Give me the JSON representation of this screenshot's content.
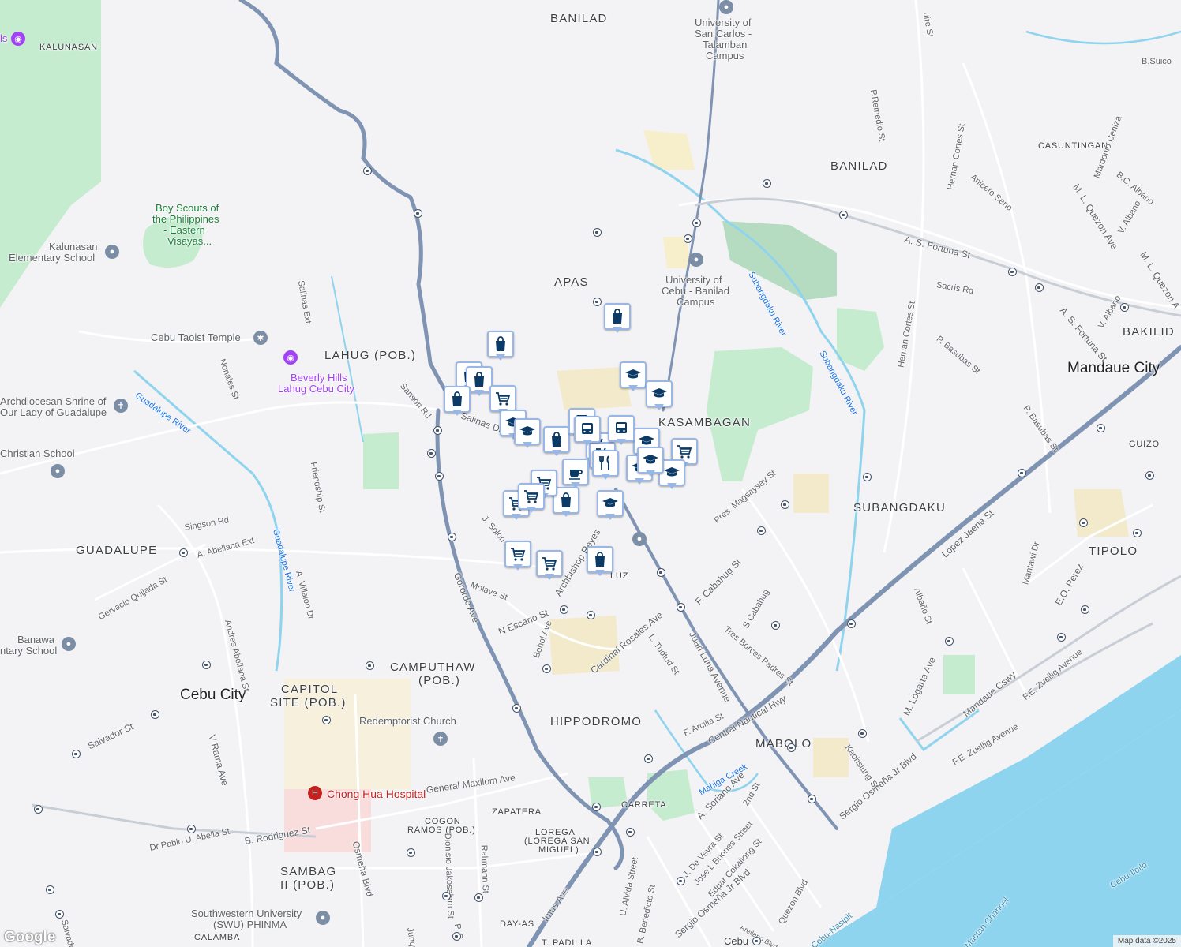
{
  "colors": {
    "background": "#f3f2f4",
    "park": "#c6ecd0",
    "water": "#8ed4ee",
    "highway": "#7f93b3",
    "road": "#ffffff",
    "pin_border": "#99b7e6",
    "pin_icon": "#0b3a66",
    "hospital": "#c5221f"
  },
  "areas": [
    {
      "name": "BANILAD",
      "key": "banilad-north"
    },
    {
      "name": "BANILAD",
      "key": "banilad"
    },
    {
      "name": "APAS",
      "key": "apas"
    },
    {
      "name": "LAHUG (POB.)",
      "key": "lahug"
    },
    {
      "name": "KASAMBAGAN",
      "key": "kasambagan"
    },
    {
      "name": "SUBANGDAKU",
      "key": "subangdaku"
    },
    {
      "name": "BAKILID",
      "key": "bakilid"
    },
    {
      "name": "TIPOLO",
      "key": "tipolo"
    },
    {
      "name": "GUADALUPE",
      "key": "guadalupe"
    },
    {
      "name": "CAMPUTHAW",
      "key": "camputhaw"
    },
    {
      "name": "(POB.)",
      "key": "camputhaw-pob"
    },
    {
      "name": "CAPITOL",
      "key": "capitol"
    },
    {
      "name": "SITE (POB.)",
      "key": "capitol-site"
    },
    {
      "name": "HIPPODROMO",
      "key": "hippodromo"
    },
    {
      "name": "MABOLO",
      "key": "mabolo"
    },
    {
      "name": "SAMBAG",
      "key": "sambag"
    },
    {
      "name": "II (POB.)",
      "key": "sambag-ii"
    },
    {
      "name": "KALUNASAN",
      "key": "kalunasan"
    },
    {
      "name": "CASUNTINGAN",
      "key": "casuntingan"
    },
    {
      "name": "GUIZO",
      "key": "guizo"
    },
    {
      "name": "LUZ",
      "key": "luz"
    },
    {
      "name": "CARRETA",
      "key": "carreta"
    },
    {
      "name": "ZAPATERA",
      "key": "zapatera"
    },
    {
      "name": "COGON",
      "key": "cogon"
    },
    {
      "name": "RAMOS (POB.)",
      "key": "cogon-ramos"
    },
    {
      "name": "LOREGA",
      "key": "lorega"
    },
    {
      "name": "(LOREGA SAN",
      "key": "lorega-2"
    },
    {
      "name": "MIGUEL)",
      "key": "lorega-3"
    },
    {
      "name": "CALAMBA",
      "key": "calamba"
    },
    {
      "name": "DAY-AS",
      "key": "dayas"
    },
    {
      "name": "T. PADILLA",
      "key": "tpadilla"
    }
  ],
  "cities": [
    {
      "name": "Mandaue City"
    },
    {
      "name": "Cebu City"
    },
    {
      "name": "Cebu"
    }
  ],
  "pois": [
    {
      "name": "University of",
      "key": "usc-1"
    },
    {
      "name": "San Carlos -",
      "key": "usc-2"
    },
    {
      "name": "Talamban",
      "key": "usc-3"
    },
    {
      "name": "Campus",
      "key": "usc-4"
    },
    {
      "name": "University of",
      "key": "uc-1"
    },
    {
      "name": "Cebu - Banilad",
      "key": "uc-2"
    },
    {
      "name": "Campus",
      "key": "uc-3"
    },
    {
      "name": "Boy Scouts of",
      "key": "bs-1"
    },
    {
      "name": "the Philippines",
      "key": "bs-2"
    },
    {
      "name": "- Eastern",
      "key": "bs-3"
    },
    {
      "name": "Visayas...",
      "key": "bs-4"
    },
    {
      "name": "Kalunasan",
      "key": "kes-1"
    },
    {
      "name": "Elementary School",
      "key": "kes-2"
    },
    {
      "name": "Cebu Taoist Temple",
      "key": "taoist"
    },
    {
      "name": "Beverly Hills",
      "key": "bh-1"
    },
    {
      "name": "Lahug Cebu City",
      "key": "bh-2"
    },
    {
      "name": "Archdiocesan Shrine of",
      "key": "shrine-1"
    },
    {
      "name": "Our Lady of Guadalupe",
      "key": "shrine-2"
    },
    {
      "name": "Christian School",
      "key": "christian"
    },
    {
      "name": "Banawa",
      "key": "banawa-1"
    },
    {
      "name": "ntary School",
      "key": "banawa-2"
    },
    {
      "name": "Redemptorist Church",
      "key": "redemptorist"
    },
    {
      "name": "Chong Hua Hospital",
      "key": "chonghua"
    },
    {
      "name": "Southwestern University",
      "key": "swu-1"
    },
    {
      "name": "(SWU) PHINMA",
      "key": "swu-2"
    },
    {
      "name": "ls",
      "key": "ls"
    }
  ],
  "streets": [
    {
      "name": "A. S. Fortuna St",
      "key": "asfortuna"
    },
    {
      "name": "A. S. Fortuna St",
      "key": "asfortuna-2"
    },
    {
      "name": "Hernan Cortes St",
      "key": "hernan-1"
    },
    {
      "name": "Hernan Cortes St",
      "key": "hernan-2"
    },
    {
      "name": "Sacris Rd",
      "key": "sacris"
    },
    {
      "name": "P. Basubas St",
      "key": "basubas-1"
    },
    {
      "name": "P. Basubas St",
      "key": "basubas-2"
    },
    {
      "name": "M. L. Quezon Ave",
      "key": "mlq"
    },
    {
      "name": "M. L. Quezon A",
      "key": "mlq-2"
    },
    {
      "name": "Lopez Jaena St",
      "key": "lopezjaena"
    },
    {
      "name": "Pres. Magsaysay St",
      "key": "magsaysay"
    },
    {
      "name": "F. Cabahug St",
      "key": "cabahug"
    },
    {
      "name": "S Cabahug",
      "key": "scabahug"
    },
    {
      "name": "Tres Borces Padres St",
      "key": "tresborces"
    },
    {
      "name": "Juan Luna Avenue",
      "key": "juanluna"
    },
    {
      "name": "Cardinal Rosales Ave",
      "key": "cardinal"
    },
    {
      "name": "Central Nautical Hwy",
      "key": "nautical"
    },
    {
      "name": "Archbishop Reyes",
      "key": "archbishop"
    },
    {
      "name": "N Escario St",
      "key": "escario"
    },
    {
      "name": "Gorordo Ave",
      "key": "gorordo"
    },
    {
      "name": "Bohol Ave",
      "key": "bohol"
    },
    {
      "name": "L. Tudtud St",
      "key": "tudtud"
    },
    {
      "name": "F. Arcilla St",
      "key": "arcilla"
    },
    {
      "name": "Molave St",
      "key": "molave"
    },
    {
      "name": "J. Solon Dr",
      "key": "solon"
    },
    {
      "name": "Salinas Dr",
      "key": "salinas"
    },
    {
      "name": "Sanson Rd",
      "key": "sanson"
    },
    {
      "name": "Salinas Ext",
      "key": "salinasext"
    },
    {
      "name": "Nonales St",
      "key": "nonales"
    },
    {
      "name": "Friendship St",
      "key": "friendship"
    },
    {
      "name": "Singson Rd",
      "key": "singson"
    },
    {
      "name": "A. Abellana Ext",
      "key": "abellanaext"
    },
    {
      "name": "A. Villalon Dr",
      "key": "villalon"
    },
    {
      "name": "Gervacio Quijada St",
      "key": "quijada"
    },
    {
      "name": "Andres Abellana St",
      "key": "andresabellana"
    },
    {
      "name": "Salvador St",
      "key": "salvador"
    },
    {
      "name": "V Rama Ave",
      "key": "vrama"
    },
    {
      "name": "General Maxilom Ave",
      "key": "maxilom"
    },
    {
      "name": "B. Rodriguez St",
      "key": "rodriguez"
    },
    {
      "name": "Dr Pablo U. Abella St",
      "key": "abella"
    },
    {
      "name": "Osmeña Blvd",
      "key": "osmena"
    },
    {
      "name": "Dionisio Jakosalem St",
      "key": "jakosalem"
    },
    {
      "name": "Rahmann St",
      "key": "rahmann"
    },
    {
      "name": "Imus Ave",
      "key": "imus"
    },
    {
      "name": "Junquera Ext",
      "key": "junquera"
    },
    {
      "name": "A. Soriano Ave",
      "key": "soriano"
    },
    {
      "name": "2nd St",
      "key": "2nd"
    },
    {
      "name": "J. De Veyra St",
      "key": "deveyra"
    },
    {
      "name": "Jose L Briones Street",
      "key": "briones"
    },
    {
      "name": "Edgar Cokaliong St",
      "key": "cokaliong"
    },
    {
      "name": "Sergio Osmeña Jr Blvd",
      "key": "sergio-1"
    },
    {
      "name": "Sergio Osmeña Jr Blvd",
      "key": "sergio-2"
    },
    {
      "name": "Kaohsiung St",
      "key": "kaohsiung"
    },
    {
      "name": "M. Logarta Ave",
      "key": "logarta"
    },
    {
      "name": "Mandaue Cswy",
      "key": "cswy"
    },
    {
      "name": "F.E. Zuellig Avenue",
      "key": "zuellig-1"
    },
    {
      "name": "F.E. Zuellig Avenue",
      "key": "zuellig-2"
    },
    {
      "name": "E.O. Perez",
      "key": "perez"
    },
    {
      "name": "Mantawi Dr",
      "key": "mantawi"
    },
    {
      "name": "Albaño St",
      "key": "albano-st"
    },
    {
      "name": "V. Albano",
      "key": "valbano"
    },
    {
      "name": "V. Albano",
      "key": "valbano-2"
    },
    {
      "name": "Mardonio Ceniza",
      "key": "ceniza"
    },
    {
      "name": "B.C. Albano",
      "key": "bcalbano"
    },
    {
      "name": "Aniceto Seno",
      "key": "seno"
    },
    {
      "name": "P.Remedio St",
      "key": "remedio"
    },
    {
      "name": "B.Suico",
      "key": "suico"
    },
    {
      "name": "U. Alvida Street",
      "key": "alvida"
    },
    {
      "name": "B. Benedicto St",
      "key": "benedicto"
    },
    {
      "name": "Quezon Blvd",
      "key": "quezonblvd"
    },
    {
      "name": "Arellano Blvd",
      "key": "arellano"
    },
    {
      "name": "P. C",
      "key": "pc"
    },
    {
      "name": "Salvador",
      "key": "salvador-2"
    },
    {
      "name": "uire St",
      "key": "uire"
    }
  ],
  "water_labels": [
    {
      "name": "Subangdaku River",
      "key": "subangdaku-river-1"
    },
    {
      "name": "Subangdaku River",
      "key": "subangdaku-river-2"
    },
    {
      "name": "Guadalupe River",
      "key": "guadalupe-river-1"
    },
    {
      "name": "Guadalupe River",
      "key": "guadalupe-river-2"
    },
    {
      "name": "Mahiga Creek",
      "key": "mahiga"
    },
    {
      "name": "Cebu-Iloilo",
      "key": "cebu-iloilo"
    },
    {
      "name": "Cebu-Nasipit",
      "key": "cebu-nasipit"
    },
    {
      "name": "Mactan Channel",
      "key": "mactan"
    }
  ],
  "markers": [
    {
      "type": "shopping",
      "icon": "shopping-bag-icon"
    },
    {
      "type": "shopping",
      "icon": "shopping-bag-icon"
    },
    {
      "type": "shopping",
      "icon": "shopping-bag-icon"
    },
    {
      "type": "shopping",
      "icon": "shopping-bag-icon"
    },
    {
      "type": "shopping",
      "icon": "shopping-bag-icon"
    },
    {
      "type": "shopping",
      "icon": "shopping-bag-icon"
    },
    {
      "type": "shopping",
      "icon": "shopping-bag-icon"
    },
    {
      "type": "shopping",
      "icon": "shopping-bag-icon"
    },
    {
      "type": "grocery",
      "icon": "shopping-cart-icon"
    },
    {
      "type": "grocery",
      "icon": "shopping-cart-icon"
    },
    {
      "type": "grocery",
      "icon": "shopping-cart-icon"
    },
    {
      "type": "grocery",
      "icon": "shopping-cart-icon"
    },
    {
      "type": "grocery",
      "icon": "shopping-cart-icon"
    },
    {
      "type": "grocery",
      "icon": "shopping-cart-icon"
    },
    {
      "type": "grocery",
      "icon": "shopping-cart-icon"
    },
    {
      "type": "school",
      "icon": "graduation-cap-icon"
    },
    {
      "type": "school",
      "icon": "graduation-cap-icon"
    },
    {
      "type": "school",
      "icon": "graduation-cap-icon"
    },
    {
      "type": "school",
      "icon": "graduation-cap-icon"
    },
    {
      "type": "school",
      "icon": "graduation-cap-icon"
    },
    {
      "type": "school",
      "icon": "graduation-cap-icon"
    },
    {
      "type": "school",
      "icon": "graduation-cap-icon"
    },
    {
      "type": "school",
      "icon": "graduation-cap-icon"
    },
    {
      "type": "school",
      "icon": "graduation-cap-icon"
    },
    {
      "type": "restaurant",
      "icon": "fork-knife-icon"
    },
    {
      "type": "restaurant",
      "icon": "fork-knife-icon"
    },
    {
      "type": "restaurant",
      "icon": "fork-knife-icon"
    },
    {
      "type": "cafe",
      "icon": "coffee-cup-icon"
    },
    {
      "type": "transit",
      "icon": "bus-icon"
    },
    {
      "type": "transit",
      "icon": "bus-icon"
    },
    {
      "type": "transit",
      "icon": "bus-icon"
    }
  ],
  "logo": "Google",
  "attribution": "Map data ©2025"
}
